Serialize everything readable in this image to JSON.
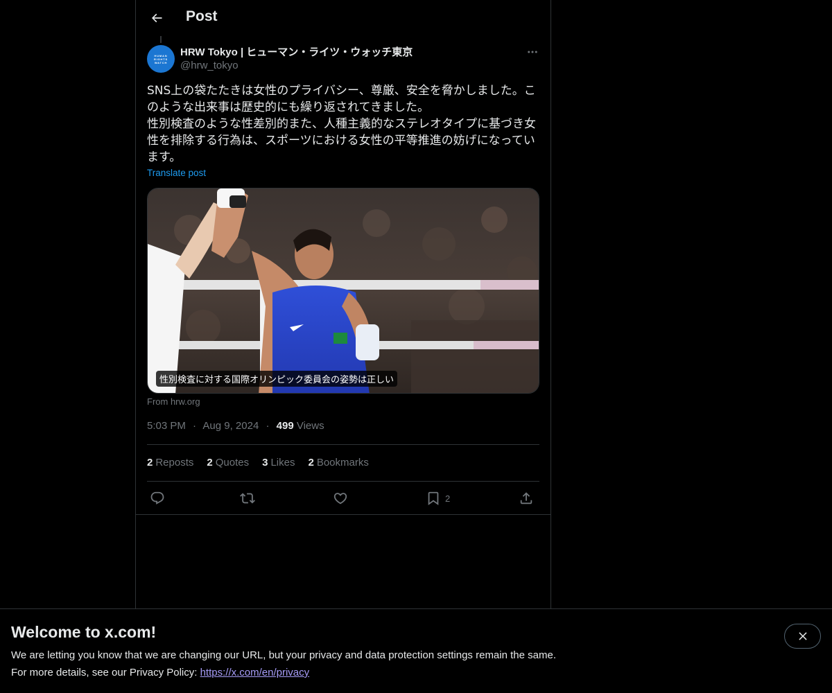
{
  "header": {
    "title": "Post",
    "back_icon": "arrow-left-icon"
  },
  "post": {
    "author": {
      "display_name": "HRW Tokyo | ヒューマン・ライツ・ウォッチ東京",
      "handle": "@hrw_tokyo",
      "avatar_lines": [
        "HUMAN",
        "RIGHTS",
        "WATCH"
      ],
      "avatar_color": "#1b76d2"
    },
    "text": "SNS上の袋たたきは女性のプライバシー、尊厳、安全を脅かしました。このような出来事は歴史的にも繰り返されてきました。\n性別検査のような性差別的また、人種主義的なステレオタイプに基づき女性を排除する行為は、スポーツにおける女性の平等推進の妨げになっています。",
    "translate_label": "Translate post",
    "card": {
      "caption": "性別検査に対する国際オリンピック委員会の姿勢は正しい",
      "source": "From hrw.org"
    },
    "meta": {
      "time": "5:03 PM",
      "date": "Aug 9, 2024",
      "views_count": "499",
      "views_label": "Views"
    },
    "stats": {
      "reposts_count": "2",
      "reposts_label": "Reposts",
      "quotes_count": "2",
      "quotes_label": "Quotes",
      "likes_count": "3",
      "likes_label": "Likes",
      "bookmarks_count": "2",
      "bookmarks_label": "Bookmarks"
    },
    "actions": {
      "bookmark_count": "2"
    }
  },
  "banner": {
    "title": "Welcome to x.com!",
    "line1": "We are letting you know that we are changing our URL, but your privacy and data protection settings remain the same.",
    "line2_prefix": "For more details, see our Privacy Policy: ",
    "privacy_link": "https://x.com/en/privacy"
  },
  "colors": {
    "background": "#000000",
    "text_primary": "#e7e9ea",
    "text_secondary": "#71767b",
    "accent_blue": "#1d9bf0",
    "border": "#2f3336",
    "link_visited": "#a69cf7"
  }
}
